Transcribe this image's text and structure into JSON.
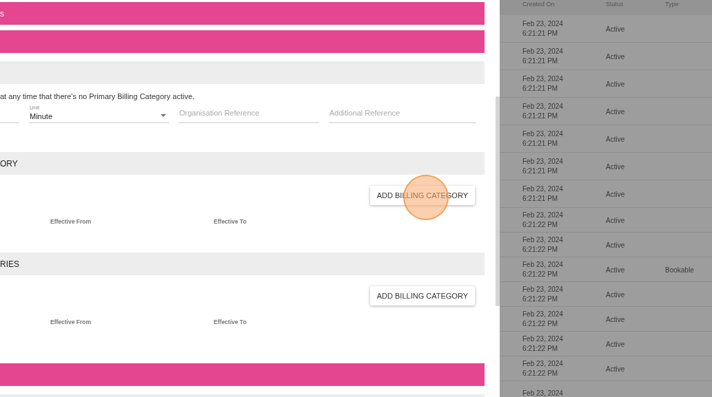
{
  "panel": {
    "blocks": [
      {
        "kind": "banner",
        "title": "s"
      },
      {
        "kind": "banner"
      },
      {
        "kind": "subheader"
      },
      {
        "kind": "note",
        "text": "at any time that there's no Primary Billing Category active."
      },
      {
        "kind": "fields",
        "fields": [
          {
            "kind": "text"
          },
          {
            "kind": "select",
            "label": "Unit",
            "value": "Minute"
          },
          {
            "kind": "text",
            "placeholder": "Organisation Reference"
          },
          {
            "kind": "text",
            "placeholder": "Additional Reference"
          }
        ]
      },
      {
        "kind": "subheader",
        "title": "ORY"
      },
      {
        "kind": "category",
        "button": "ADD BILLING CATEGORY",
        "columns": [
          "Effective From",
          "Effective To"
        ]
      },
      {
        "kind": "subheader",
        "title": "RIES"
      },
      {
        "kind": "category",
        "button": "ADD BILLING CATEGORY",
        "columns": [
          "Effective From",
          "Effective To"
        ]
      },
      {
        "kind": "banner"
      },
      {
        "kind": "subheader"
      }
    ]
  },
  "table": {
    "columns": [
      "Created On",
      "Status",
      "Type"
    ],
    "rows": [
      {
        "created": "Feb 23, 2024",
        "time": "6:21:21 PM",
        "status": "Active"
      },
      {
        "created": "Feb 23, 2024",
        "time": "6:21:21 PM",
        "status": "Active"
      },
      {
        "created": "Feb 23, 2024",
        "time": "6:21:21 PM",
        "status": "Active"
      },
      {
        "created": "Feb 23, 2024",
        "time": "6:21:21 PM",
        "status": "Active"
      },
      {
        "created": "Feb 23, 2024",
        "time": "6:21:21 PM",
        "status": "Active"
      },
      {
        "created": "Feb 23, 2024",
        "time": "6:21:21 PM",
        "status": "Active"
      },
      {
        "created": "Feb 23, 2024",
        "time": "6:21:21 PM",
        "status": "Active"
      },
      {
        "created": "Feb 23, 2024",
        "time": "6:21:22 PM",
        "status": "Active"
      },
      {
        "created": "Feb 23, 2024",
        "time": "6:21:22 PM",
        "status": "Active"
      },
      {
        "created": "Feb 23, 2024",
        "time": "6:21:22 PM",
        "status": "Active",
        "type": "Bookable"
      },
      {
        "created": "Feb 23, 2024",
        "time": "6:21:22 PM",
        "status": "Active"
      },
      {
        "created": "Feb 23, 2024",
        "time": "6:21:22 PM",
        "status": "Active"
      },
      {
        "created": "Feb 23, 2024",
        "time": "6:21:22 PM",
        "status": "Active"
      },
      {
        "created": "Feb 23, 2024",
        "time": "6:21:22 PM",
        "status": "Active"
      },
      {
        "created": "Feb 23, 2024"
      }
    ]
  }
}
